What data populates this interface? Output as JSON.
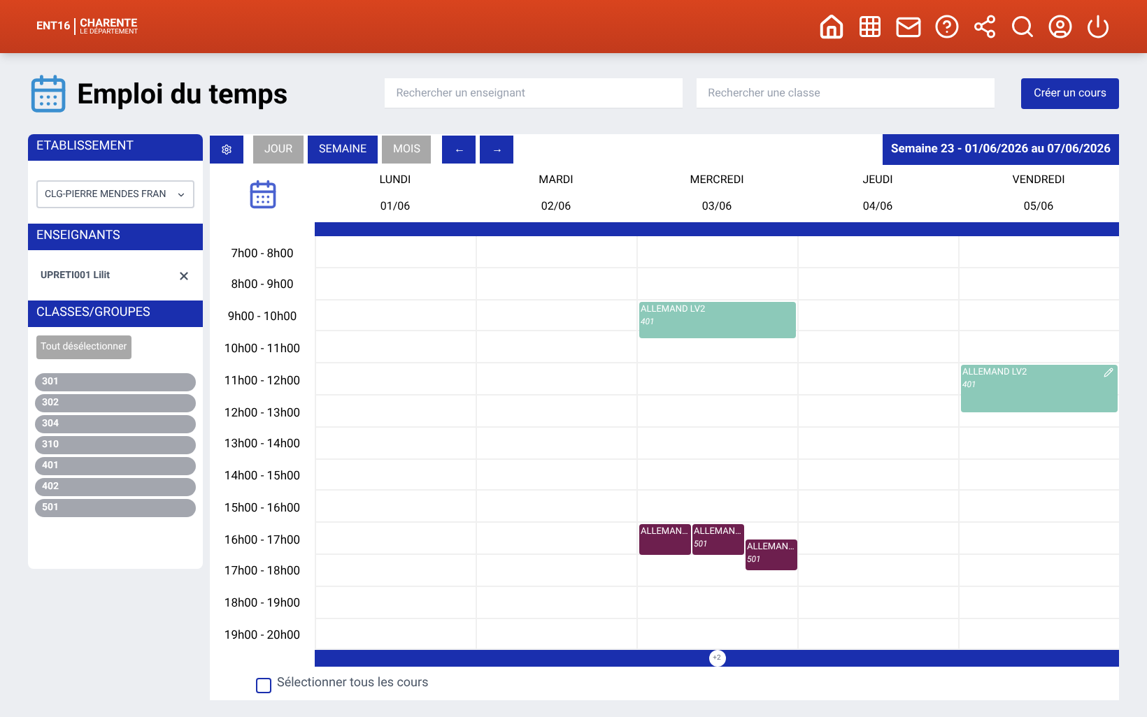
{
  "header": {
    "logo": {
      "left": "ENT16",
      "right": "CHARENTE",
      "sub": "LE DÉPARTEMENT"
    }
  },
  "page": {
    "title": "Emploi du temps",
    "teacher_search": {
      "placeholder": "Rechercher un enseignant"
    },
    "class_search": {
      "placeholder": "Rechercher une classe"
    },
    "create_button": "Créer un cours"
  },
  "sidebar": {
    "school": {
      "heading": "ETABLISSEMENT",
      "value": "CLG-PIERRE MENDES FRAN"
    },
    "teachers": {
      "heading": "ENSEIGNANTS",
      "items": [
        {
          "name": "UPRETI001 Lilit"
        }
      ]
    },
    "classes": {
      "heading": "CLASSES/GROUPES",
      "deselect": "Tout désélectionner",
      "items": [
        "301",
        "302",
        "304",
        "310",
        "401",
        "402",
        "501"
      ]
    }
  },
  "toolbar": {
    "views": [
      {
        "label": "JOUR",
        "selected": false
      },
      {
        "label": "SEMAINE",
        "selected": true
      },
      {
        "label": "MOIS",
        "selected": false
      }
    ],
    "prev": "←",
    "next": "→",
    "week": "Semaine 23 - 01/06/2026 au 07/06/2026"
  },
  "days": [
    {
      "name": "LUNDI",
      "date": "01/06"
    },
    {
      "name": "MARDI",
      "date": "02/06"
    },
    {
      "name": "MERCREDI",
      "date": "03/06"
    },
    {
      "name": "JEUDI",
      "date": "04/06"
    },
    {
      "name": "VENDREDI",
      "date": "05/06"
    }
  ],
  "rows": [
    {
      "label": "7h00 - 8h00",
      "cells": [
        {},
        {},
        {},
        {},
        {}
      ]
    },
    {
      "label": "8h00 - 9h00",
      "cells": [
        {},
        {},
        {},
        {},
        {}
      ]
    },
    {
      "label": "9h00 - 10h00",
      "cells": [
        {},
        {},
        {
          "courses": [
            {
              "title": "ALLEMAND LV2",
              "group": "401",
              "color": "#8cc9b9",
              "kind": "short",
              "editable": false
            }
          ]
        },
        {},
        {}
      ]
    },
    {
      "label": "10h00 - 11h00",
      "cells": [
        {},
        {},
        {},
        {},
        {}
      ]
    },
    {
      "label": "11h00 - 12h00",
      "cells": [
        {},
        {},
        {},
        {},
        {
          "courses": [
            {
              "title": "ALLEMAND LV2",
              "group": "401",
              "color": "#8cc9b9",
              "kind": "tall",
              "editable": true
            }
          ]
        }
      ]
    },
    {
      "label": "12h00 - 13h00",
      "cells": [
        {},
        {},
        {},
        {},
        {}
      ]
    },
    {
      "label": "13h00 - 14h00",
      "cells": [
        {},
        {},
        {},
        {},
        {}
      ]
    },
    {
      "label": "14h00 - 15h00",
      "cells": [
        {},
        {},
        {},
        {},
        {}
      ]
    },
    {
      "label": "15h00 - 16h00",
      "cells": [
        {},
        {},
        {},
        {},
        {}
      ]
    },
    {
      "label": "16h00 - 17h00",
      "cells": [
        {},
        {},
        {
          "courses": [
            {
              "title": "ALLEMAN…",
              "color": "#6d1f4e",
              "kind": "narrow",
              "editable": false
            },
            {
              "title": "ALLEMAN…",
              "group": "501",
              "color": "#6d1f4e",
              "kind": "narrow",
              "editable": false
            },
            {
              "title": "ALLEMAN…",
              "group": "501",
              "color": "#6d1f4e",
              "kind": "narrow-late",
              "editable": false
            }
          ]
        },
        {},
        {}
      ]
    },
    {
      "label": "17h00 - 18h00",
      "cells": [
        {},
        {},
        {},
        {},
        {}
      ]
    },
    {
      "label": "18h00 - 19h00",
      "cells": [
        {},
        {},
        {},
        {},
        {}
      ]
    },
    {
      "label": "19h00 - 20h00",
      "cells": [
        {},
        {},
        {},
        {},
        {}
      ]
    }
  ],
  "more_badge": "+2",
  "select_all": {
    "label": "Sélectionner tous les cours",
    "checked": false
  }
}
